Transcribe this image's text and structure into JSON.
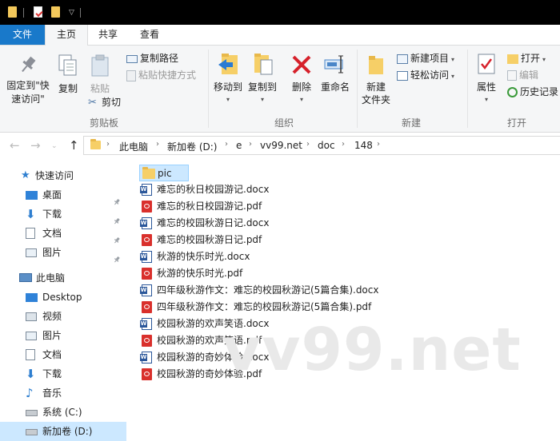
{
  "tabs": {
    "file": "文件",
    "home": "主页",
    "share": "共享",
    "view": "查看"
  },
  "ribbon": {
    "clipboard": {
      "pin_to_quick_access": "固定到\"快速访问\"",
      "copy": "复制",
      "paste": "粘贴",
      "copy_path": "复制路径",
      "paste_shortcut": "粘贴快捷方式",
      "cut": "剪切",
      "label": "剪贴板"
    },
    "organize": {
      "move_to": "移动到",
      "copy_to": "复制到",
      "delete": "删除",
      "rename": "重命名",
      "label": "组织"
    },
    "new": {
      "new_folder": "新建\n文件夹",
      "new_item": "新建项目",
      "easy_access": "轻松访问",
      "label": "新建"
    },
    "open": {
      "properties": "属性",
      "open": "打开",
      "edit": "编辑",
      "history": "历史记录",
      "label": "打开"
    }
  },
  "address": {
    "crumbs": [
      "此电脑",
      "新加卷 (D:)",
      "e",
      "vv99.net",
      "doc",
      "148"
    ]
  },
  "nav_pane": {
    "quick_access": "快速访问",
    "desktop": "桌面",
    "downloads": "下载",
    "documents": "文档",
    "pictures": "图片",
    "this_pc": "此电脑",
    "pc_desktop": "Desktop",
    "videos": "视频",
    "pc_pictures": "图片",
    "pc_documents": "文档",
    "pc_downloads": "下载",
    "music": "音乐",
    "system_c": "系统 (C:)",
    "new_volume_d": "新加卷 (D:)"
  },
  "files": [
    {
      "name": "pic",
      "type": "folder"
    },
    {
      "name": "难忘的秋日校园游记.docx",
      "type": "docx"
    },
    {
      "name": "难忘的秋日校园游记.pdf",
      "type": "pdf"
    },
    {
      "name": "难忘的校园秋游日记.docx",
      "type": "docx"
    },
    {
      "name": "难忘的校园秋游日记.pdf",
      "type": "pdf"
    },
    {
      "name": "秋游的快乐时光.docx",
      "type": "docx"
    },
    {
      "name": "秋游的快乐时光.pdf",
      "type": "pdf"
    },
    {
      "name": "四年级秋游作文：难忘的校园秋游记(5篇合集).docx",
      "type": "docx"
    },
    {
      "name": "四年级秋游作文：难忘的校园秋游记(5篇合集).pdf",
      "type": "pdf"
    },
    {
      "name": "校园秋游的欢声笑语.docx",
      "type": "docx"
    },
    {
      "name": "校园秋游的欢声笑语.pdf",
      "type": "pdf"
    },
    {
      "name": "校园秋游的奇妙体验.docx",
      "type": "docx"
    },
    {
      "name": "校园秋游的奇妙体验.pdf",
      "type": "pdf"
    }
  ],
  "watermark": "vv99.net",
  "colors": {
    "accent": "#1979ca",
    "selection": "#cce8ff",
    "folder": "#f6cf67",
    "word": "#2b579a",
    "pdf": "#d9302c"
  }
}
